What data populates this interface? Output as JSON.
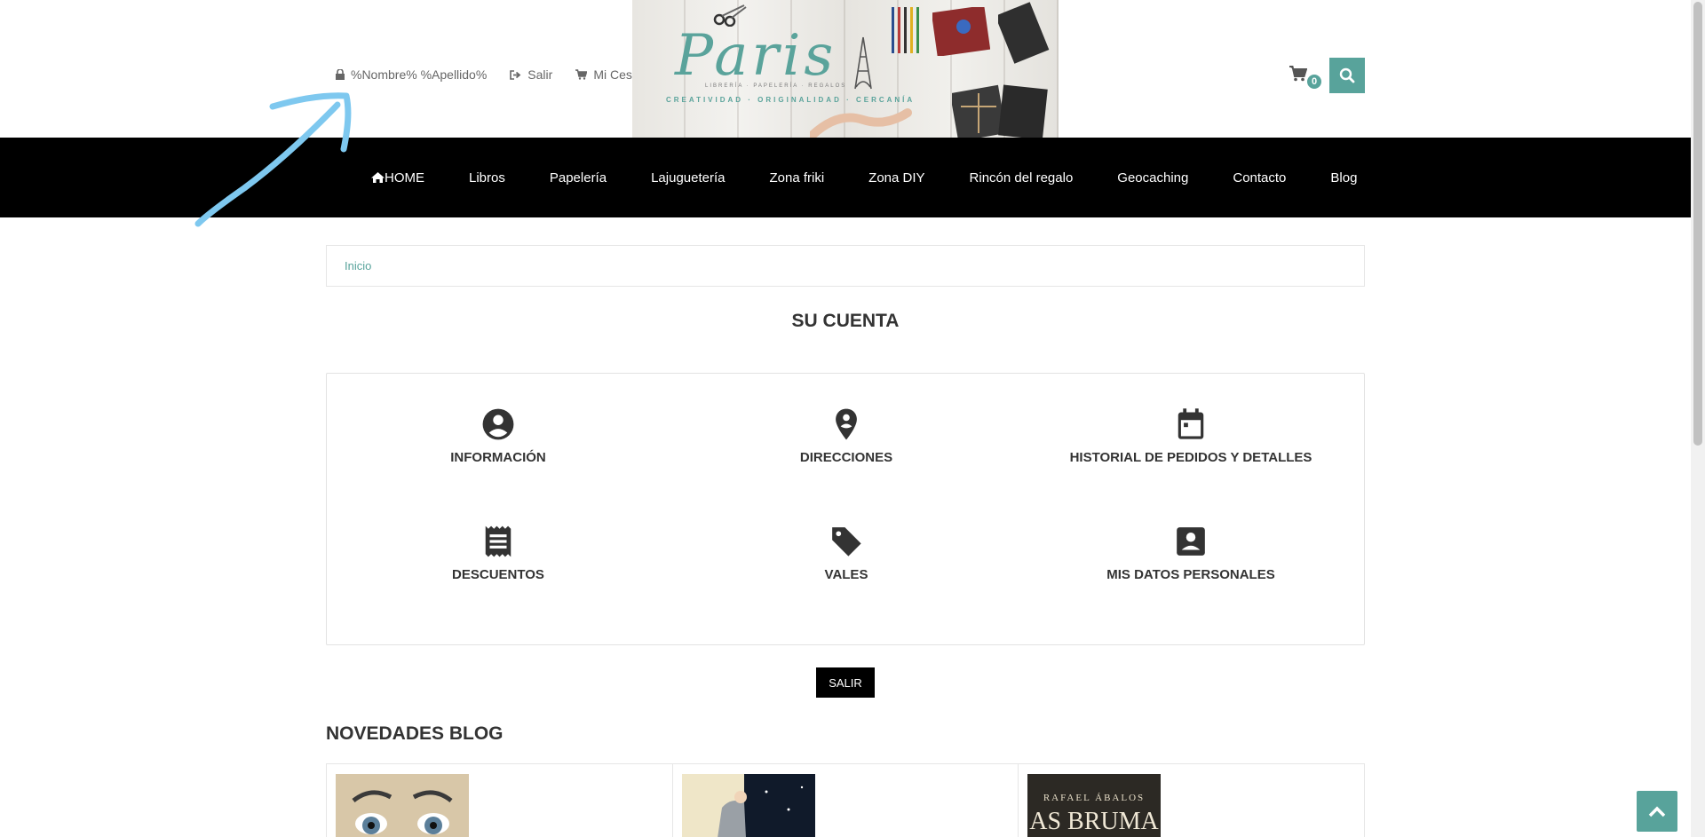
{
  "header": {
    "user_name": "%Nombre% %Apellido%",
    "logout_label": "Salir",
    "cart_label": "Mi Cesta",
    "cart_count": "0",
    "logo": {
      "brand": "Paris",
      "tagline": "LIBRERÍA · PAPELERÍA · REGALOS",
      "slogan": "CREATIVIDAD · ORIGINALIDAD · CERCANÍA"
    }
  },
  "nav": {
    "items": [
      "HOME",
      "Libros",
      "Papelería",
      "Lajuguetería",
      "Zona friki",
      "Zona DIY",
      "Rincón del regalo",
      "Geocaching",
      "Contacto",
      "Blog"
    ]
  },
  "breadcrumb": {
    "home": "Inicio"
  },
  "account": {
    "title": "SU CUENTA",
    "links": [
      {
        "label": "INFORMACIÓN",
        "icon": "account-circle-icon"
      },
      {
        "label": "DIRECCIONES",
        "icon": "map-pin-icon"
      },
      {
        "label": "HISTORIAL DE PEDIDOS Y DETALLES",
        "icon": "calendar-icon"
      },
      {
        "label": "DESCUENTOS",
        "icon": "receipt-icon"
      },
      {
        "label": "VALES",
        "icon": "tag-icon"
      },
      {
        "label": "MIS DATOS PERSONALES",
        "icon": "contact-card-icon"
      }
    ],
    "logout_button": "SALIR"
  },
  "blog": {
    "title": "NOVEDADES BLOG",
    "cards": [
      {
        "thumb_text": ""
      },
      {
        "thumb_text": ""
      },
      {
        "thumb_text": "RAFAEL ÁBALOS"
      }
    ]
  },
  "colors": {
    "accent": "#58a39b",
    "nav_bg": "#000000",
    "annotation": "#7ec8ef"
  }
}
